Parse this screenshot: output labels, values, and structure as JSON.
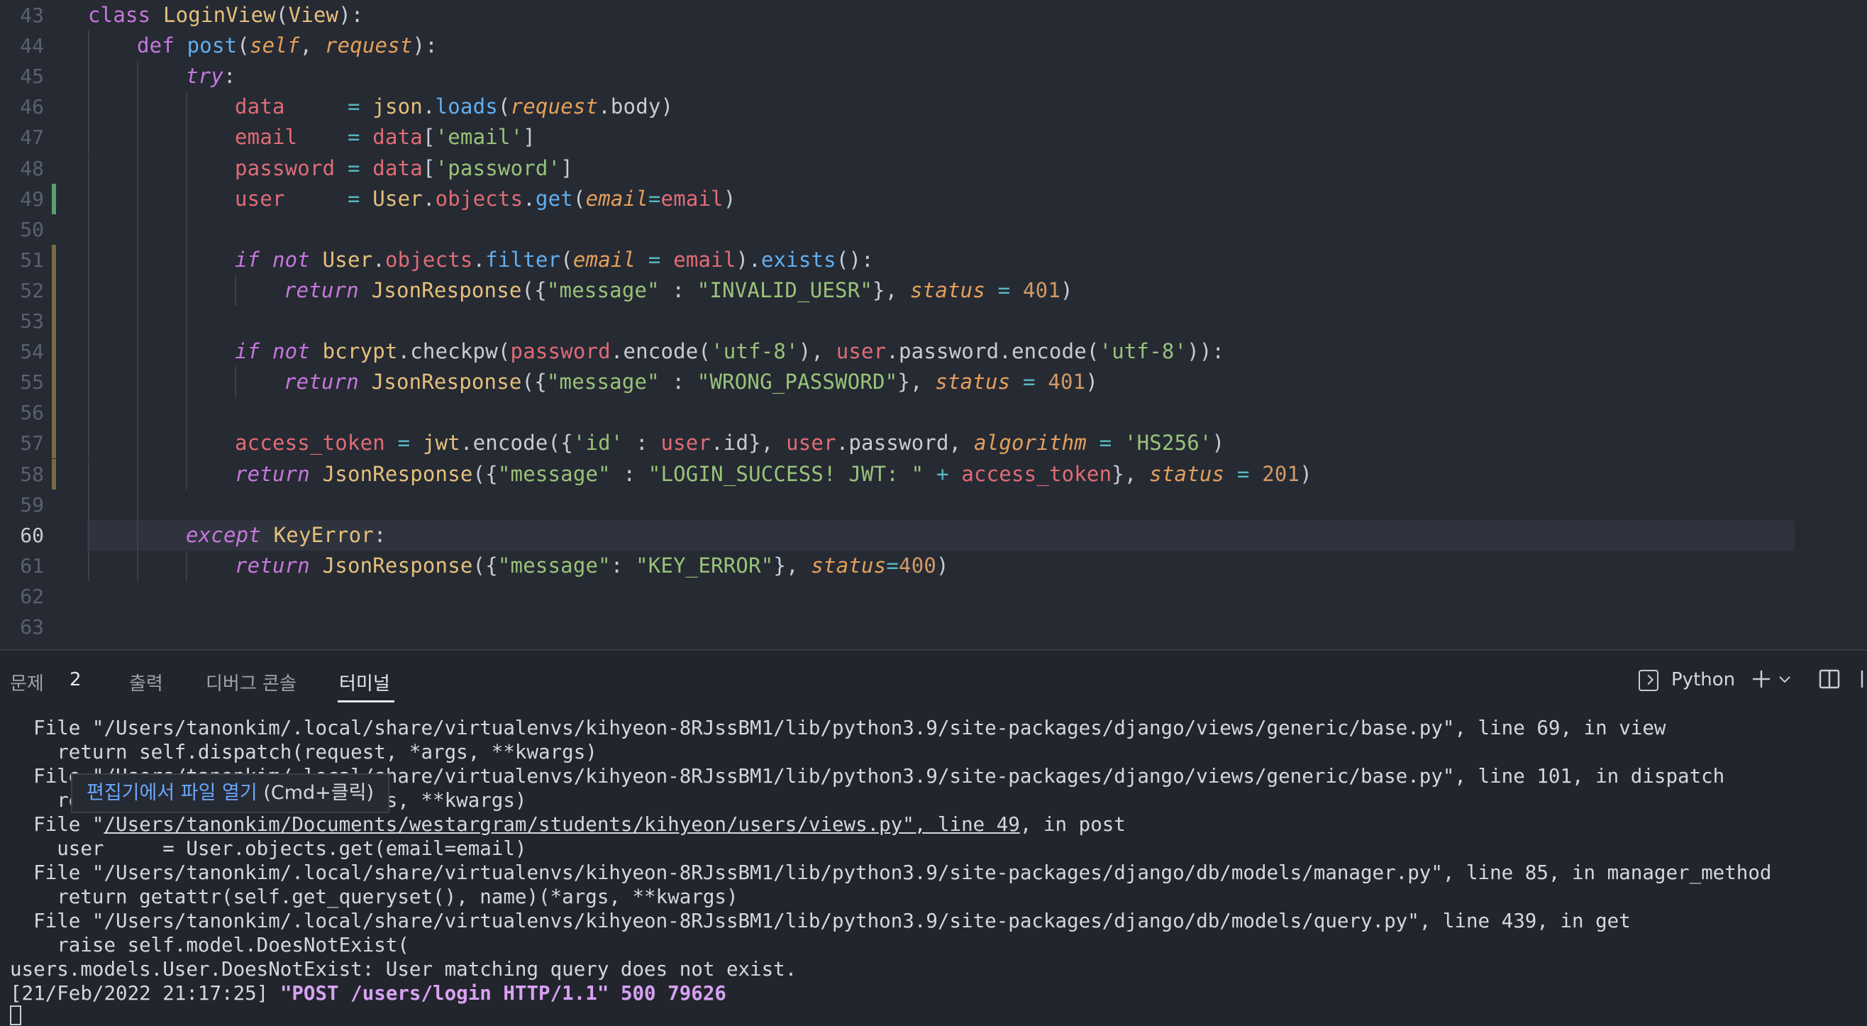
{
  "editor": {
    "lines": [
      {
        "n": "43",
        "gutter": "",
        "indent": 0,
        "segs": [
          [
            "k",
            "class "
          ],
          [
            "cl",
            "LoginView"
          ],
          [
            "pl",
            "("
          ],
          [
            "cl",
            "View"
          ],
          [
            "pl",
            "):"
          ]
        ]
      },
      {
        "n": "44",
        "gutter": "",
        "indent": 1,
        "segs": [
          [
            "k",
            "def "
          ],
          [
            "fn",
            "post"
          ],
          [
            "pl",
            "("
          ],
          [
            "pm",
            "self"
          ],
          [
            "pl",
            ", "
          ],
          [
            "pm",
            "request"
          ],
          [
            "pl",
            "):"
          ]
        ]
      },
      {
        "n": "45",
        "gutter": "",
        "indent": 2,
        "segs": [
          [
            "kw",
            "try"
          ],
          [
            "pl",
            ":"
          ]
        ]
      },
      {
        "n": "46",
        "gutter": "",
        "indent": 3,
        "segs": [
          [
            "vr",
            "data"
          ],
          [
            "pl",
            "     "
          ],
          [
            "op",
            "="
          ],
          [
            "pl",
            " "
          ],
          [
            "cl",
            "json"
          ],
          [
            "pl",
            "."
          ],
          [
            "fn",
            "loads"
          ],
          [
            "pl",
            "("
          ],
          [
            "pm",
            "request"
          ],
          [
            "pl",
            ".body)"
          ]
        ]
      },
      {
        "n": "47",
        "gutter": "",
        "indent": 3,
        "segs": [
          [
            "vr",
            "email"
          ],
          [
            "pl",
            "    "
          ],
          [
            "op",
            "="
          ],
          [
            "pl",
            " "
          ],
          [
            "vr",
            "data"
          ],
          [
            "pl",
            "["
          ],
          [
            "st",
            "'email'"
          ],
          [
            "pl",
            "]"
          ]
        ]
      },
      {
        "n": "48",
        "gutter": "",
        "indent": 3,
        "segs": [
          [
            "vr",
            "password"
          ],
          [
            "pl",
            " "
          ],
          [
            "op",
            "="
          ],
          [
            "pl",
            " "
          ],
          [
            "vr",
            "data"
          ],
          [
            "pl",
            "["
          ],
          [
            "st",
            "'password'"
          ],
          [
            "pl",
            "]"
          ]
        ]
      },
      {
        "n": "49",
        "gutter": "add",
        "indent": 3,
        "segs": [
          [
            "vr",
            "user"
          ],
          [
            "pl",
            "     "
          ],
          [
            "op",
            "="
          ],
          [
            "pl",
            " "
          ],
          [
            "cl",
            "User"
          ],
          [
            "pl",
            "."
          ],
          [
            "vr",
            "objects"
          ],
          [
            "pl",
            "."
          ],
          [
            "fn",
            "get"
          ],
          [
            "pl",
            "("
          ],
          [
            "pm",
            "email"
          ],
          [
            "op",
            "="
          ],
          [
            "vr",
            "email"
          ],
          [
            "pl",
            ")"
          ]
        ]
      },
      {
        "n": "50",
        "gutter": "",
        "indent": 3,
        "segs": []
      },
      {
        "n": "51",
        "gutter": "mod",
        "indent": 3,
        "segs": [
          [
            "kw",
            "if not "
          ],
          [
            "cl",
            "User"
          ],
          [
            "pl",
            "."
          ],
          [
            "vr",
            "objects"
          ],
          [
            "pl",
            "."
          ],
          [
            "fn",
            "filter"
          ],
          [
            "pl",
            "("
          ],
          [
            "pm",
            "email"
          ],
          [
            "pl",
            " "
          ],
          [
            "op",
            "="
          ],
          [
            "pl",
            " "
          ],
          [
            "vr",
            "email"
          ],
          [
            "pl",
            ")."
          ],
          [
            "fn",
            "exists"
          ],
          [
            "pl",
            "():"
          ]
        ]
      },
      {
        "n": "52",
        "gutter": "mod",
        "indent": 4,
        "segs": [
          [
            "kw",
            "return "
          ],
          [
            "cl",
            "JsonResponse"
          ],
          [
            "pl",
            "({"
          ],
          [
            "st",
            "\"message\""
          ],
          [
            "pl",
            " : "
          ],
          [
            "st",
            "\"INVALID_UESR\""
          ],
          [
            "pl",
            "}, "
          ],
          [
            "pm",
            "status"
          ],
          [
            "pl",
            " "
          ],
          [
            "op",
            "="
          ],
          [
            "pl",
            " "
          ],
          [
            "nu",
            "401"
          ],
          [
            "pl",
            ")"
          ]
        ]
      },
      {
        "n": "53",
        "gutter": "mod",
        "indent": 3,
        "segs": []
      },
      {
        "n": "54",
        "gutter": "mod",
        "indent": 3,
        "segs": [
          [
            "kw",
            "if not "
          ],
          [
            "cl",
            "bcrypt"
          ],
          [
            "pl",
            ".checkpw("
          ],
          [
            "vr",
            "password"
          ],
          [
            "pl",
            ".encode("
          ],
          [
            "st",
            "'utf-8'"
          ],
          [
            "pl",
            "), "
          ],
          [
            "vr",
            "user"
          ],
          [
            "pl",
            ".password.encode("
          ],
          [
            "st",
            "'utf-8'"
          ],
          [
            "pl",
            "))"
          ],
          [
            "pl",
            ":"
          ]
        ]
      },
      {
        "n": "55",
        "gutter": "mod",
        "indent": 4,
        "segs": [
          [
            "kw",
            "return "
          ],
          [
            "cl",
            "JsonResponse"
          ],
          [
            "pl",
            "({"
          ],
          [
            "st",
            "\"message\""
          ],
          [
            "pl",
            " : "
          ],
          [
            "st",
            "\"WRONG_PASSWORD\""
          ],
          [
            "pl",
            "}, "
          ],
          [
            "pm",
            "status"
          ],
          [
            "pl",
            " "
          ],
          [
            "op",
            "="
          ],
          [
            "pl",
            " "
          ],
          [
            "nu",
            "401"
          ],
          [
            "pl",
            ")"
          ]
        ]
      },
      {
        "n": "56",
        "gutter": "mod",
        "indent": 3,
        "segs": []
      },
      {
        "n": "57",
        "gutter": "mod",
        "indent": 3,
        "segs": [
          [
            "vr",
            "access_token"
          ],
          [
            "pl",
            " "
          ],
          [
            "op",
            "="
          ],
          [
            "pl",
            " "
          ],
          [
            "cl",
            "jwt"
          ],
          [
            "pl",
            ".encode({"
          ],
          [
            "st",
            "'id'"
          ],
          [
            "pl",
            " : "
          ],
          [
            "vr",
            "user"
          ],
          [
            "pl",
            ".id}, "
          ],
          [
            "vr",
            "user"
          ],
          [
            "pl",
            ".password, "
          ],
          [
            "pm",
            "algorithm"
          ],
          [
            "pl",
            " "
          ],
          [
            "op",
            "="
          ],
          [
            "pl",
            " "
          ],
          [
            "st",
            "'HS256'"
          ],
          [
            "pl",
            ")"
          ]
        ]
      },
      {
        "n": "58",
        "gutter": "mod",
        "indent": 3,
        "segs": [
          [
            "kw",
            "return "
          ],
          [
            "cl",
            "JsonResponse"
          ],
          [
            "pl",
            "({"
          ],
          [
            "st",
            "\"message\""
          ],
          [
            "pl",
            " : "
          ],
          [
            "st",
            "\"LOGIN_SUCCESS! JWT: \""
          ],
          [
            "pl",
            " "
          ],
          [
            "op",
            "+"
          ],
          [
            "pl",
            " "
          ],
          [
            "vr",
            "access_token"
          ],
          [
            "pl",
            "}, "
          ],
          [
            "pm",
            "status"
          ],
          [
            "pl",
            " "
          ],
          [
            "op",
            "="
          ],
          [
            "pl",
            " "
          ],
          [
            "nu",
            "201"
          ],
          [
            "pl",
            ")"
          ]
        ]
      },
      {
        "n": "59",
        "gutter": "",
        "indent": 2,
        "segs": []
      },
      {
        "n": "60",
        "gutter": "",
        "indent": 2,
        "current": true,
        "segs": [
          [
            "kw",
            "except "
          ],
          [
            "cl",
            "KeyError"
          ],
          [
            "pl",
            ":"
          ]
        ]
      },
      {
        "n": "61",
        "gutter": "",
        "indent": 3,
        "segs": [
          [
            "kw",
            "return "
          ],
          [
            "cl",
            "JsonResponse"
          ],
          [
            "pl",
            "({"
          ],
          [
            "st",
            "\"message\""
          ],
          [
            "pl",
            ": "
          ],
          [
            "st",
            "\"KEY_ERROR\""
          ],
          [
            "pl",
            "}, "
          ],
          [
            "pm",
            "status"
          ],
          [
            "op",
            "="
          ],
          [
            "nu",
            "400"
          ],
          [
            "pl",
            ")"
          ]
        ]
      },
      {
        "n": "62",
        "gutter": "",
        "indent": 0,
        "segs": []
      },
      {
        "n": "63",
        "gutter": "",
        "indent": 0,
        "segs": []
      }
    ]
  },
  "panel": {
    "tabs": {
      "problems": "문제",
      "problems_count": "2",
      "output": "출력",
      "debug_console": "디버그 콘솔",
      "terminal": "터미널"
    },
    "terminal_profile": "Python",
    "tooltip": {
      "link": "편집기에서 파일 열기",
      "hint": "(Cmd+클릭)"
    },
    "terminal_lines": [
      "  File \"/Users/tanonkim/.local/share/virtualenvs/kihyeon-8RJssBM1/lib/python3.9/site-packages/django/views/generic/base.py\", line 69, in view",
      "    return self.dispatch(request, *args, **kwargs)",
      "  File \"/Users/tanonkim/.local/share/virtualenvs/kihyeon-8RJssBM1/lib/python3.9/site-packages/django/views/generic/base.py\", line 101, in dispatch",
      "    return handler(request, *args, **kwargs)",
      "  File \"/Users/tanonkim/Documents/westargram/students/kihyeon/users/views.py\", line 49, in post",
      "    user     = User.objects.get(email=email)",
      "  File \"/Users/tanonkim/.local/share/virtualenvs/kihyeon-8RJssBM1/lib/python3.9/site-packages/django/db/models/manager.py\", line 85, in manager_method",
      "    return getattr(self.get_queryset(), name)(*args, **kwargs)",
      "  File \"/Users/tanonkim/.local/share/virtualenvs/kihyeon-8RJssBM1/lib/python3.9/site-packages/django/db/models/query.py\", line 439, in get",
      "    raise self.model.DoesNotExist(",
      "users.models.User.DoesNotExist: User matching query does not exist."
    ],
    "log_line": {
      "prefix": "[21/Feb/2022 21:17:25] ",
      "request": "\"POST /users/login HTTP/1.1\" 500 79626"
    },
    "link_line": {
      "pre": "  File \"",
      "link": "/Users/tanonkim/Documents/westargram/students/kihyeon/users/views.py\", line 49",
      "post": ", in post"
    }
  }
}
